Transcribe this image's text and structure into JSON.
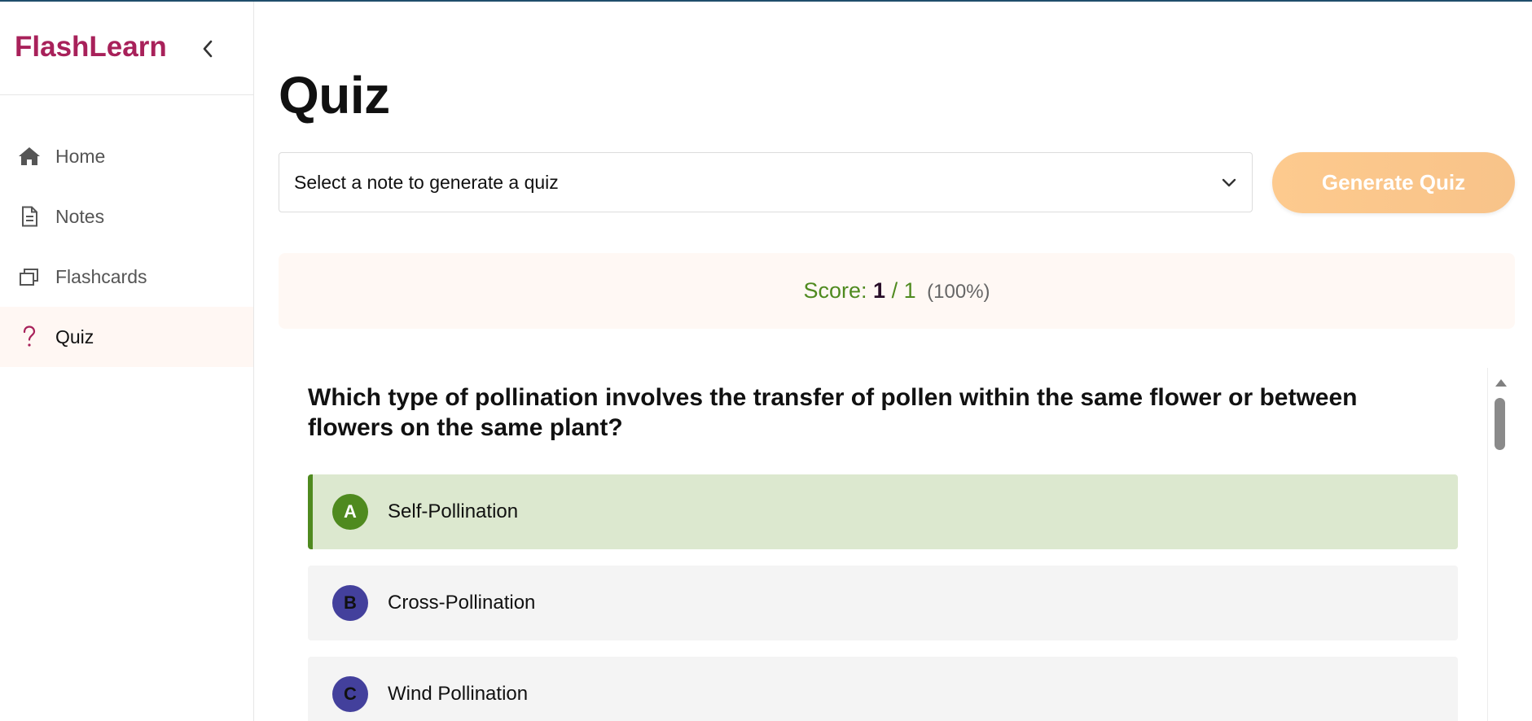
{
  "app": {
    "brand": "FlashLearn"
  },
  "sidebar": {
    "items": [
      {
        "label": "Home",
        "icon": "home-icon",
        "active": false
      },
      {
        "label": "Notes",
        "icon": "document-icon",
        "active": false
      },
      {
        "label": "Flashcards",
        "icon": "cards-icon",
        "active": false
      },
      {
        "label": "Quiz",
        "icon": "question-icon",
        "active": true
      }
    ]
  },
  "main": {
    "title": "Quiz",
    "note_select": {
      "value": "Select a note to generate a quiz"
    },
    "generate_button": "Generate Quiz",
    "score": {
      "label": "Score:",
      "correct": "1",
      "separator": "/",
      "total": "1",
      "percent": "(100%)"
    },
    "question": {
      "text": "Which type of pollination involves the transfer of pollen within the same flower or between flowers on the same plant?",
      "options": [
        {
          "letter": "A",
          "text": "Self-Pollination",
          "state": "correct"
        },
        {
          "letter": "B",
          "text": "Cross-Pollination",
          "state": "default"
        },
        {
          "letter": "C",
          "text": "Wind Pollination",
          "state": "default"
        }
      ]
    }
  },
  "colors": {
    "brand": "#a8215a",
    "accent_button": "#fdca8e",
    "correct": "#4f8a1f",
    "correct_bg": "#dce8cf",
    "option_badge": "#43409c",
    "score_bg": "#fff8f4"
  }
}
